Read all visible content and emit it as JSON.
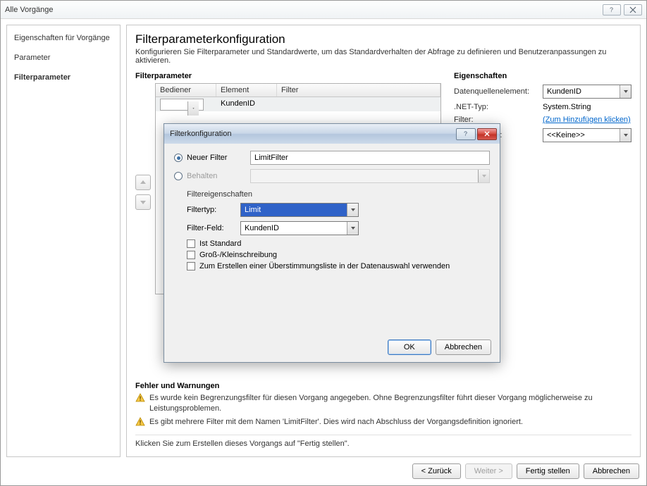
{
  "window": {
    "title": "Alle Vorgänge"
  },
  "sidebar": {
    "items": [
      {
        "label": "Eigenschaften für Vorgänge"
      },
      {
        "label": "Parameter"
      },
      {
        "label": "Filterparameter"
      }
    ]
  },
  "page": {
    "title": "Filterparameterkonfiguration",
    "subtitle": "Konfigurieren Sie Filterparameter und Standardwerte, um das Standardverhalten der Abfrage zu definieren und Benutzeranpassungen zu aktivieren."
  },
  "filterparams": {
    "heading": "Filterparameter",
    "columns": {
      "bediener": "Bediener",
      "element": "Element",
      "filter": "Filter"
    },
    "rows": [
      {
        "bediener": "",
        "element": "KundenID",
        "filter": ""
      }
    ]
  },
  "props": {
    "heading": "Eigenschaften",
    "datasource_label": "Datenquellenelement:",
    "datasource_value": "KundenID",
    "nettype_label": ".NET-Typ:",
    "nettype_value": "System.String",
    "filter_label": "Filter:",
    "filter_link": "(Zum Hinzufügen klicken)",
    "default_label": "Standardwert:",
    "default_value": "<<Keine>>"
  },
  "errors": {
    "heading": "Fehler und Warnungen",
    "items": [
      "Es wurde kein Begrenzungsfilter für diesen Vorgang angegeben. Ohne Begrenzungsfilter führt dieser Vorgang möglicherweise zu Leistungsproblemen.",
      "Es gibt mehrere Filter mit dem Namen 'LimitFilter'. Dies wird nach Abschluss der Vorgangsdefinition ignoriert."
    ]
  },
  "footer_hint": "Klicken Sie zum Erstellen dieses Vorgangs auf \"Fertig stellen\".",
  "buttons": {
    "back": "< Zurück",
    "next": "Weiter >",
    "finish": "Fertig stellen",
    "cancel": "Abbrechen"
  },
  "modal": {
    "title": "Filterkonfiguration",
    "newfilter_label": "Neuer Filter",
    "newfilter_value": "LimitFilter",
    "keep_label": "Behalten",
    "section": "Filtereigenschaften",
    "filtertyp_label": "Filtertyp:",
    "filtertyp_value": "Limit",
    "filterfeld_label": "Filter-Feld:",
    "filterfeld_value": "KundenID",
    "cb1": "Ist Standard",
    "cb2": "Groß-/Kleinschreibung",
    "cb3": "Zum Erstellen einer Überstimmungsliste in der Datenauswahl verwenden",
    "ok": "OK",
    "cancel": "Abbrechen"
  }
}
